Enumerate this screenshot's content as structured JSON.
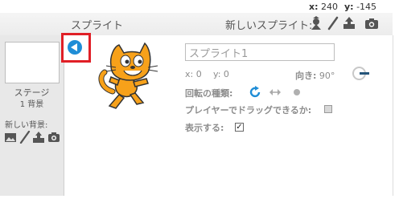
{
  "coords": {
    "x_label": "x:",
    "x_value": "240",
    "y_label": "y:",
    "y_value": "-145"
  },
  "sprites_pane": {
    "title": "スプライト",
    "new_sprite_label": "新しいスプライト:",
    "new_sprite_icons": [
      "sprite-library-icon",
      "paint-brush-icon",
      "upload-icon",
      "camera-icon"
    ]
  },
  "stage": {
    "label": "ステージ",
    "backdrop_count": "1 背景",
    "new_backdrop_label": "新しい背景:",
    "new_backdrop_icons": [
      "image-library-icon",
      "paint-brush-icon",
      "upload-icon",
      "camera-icon"
    ]
  },
  "sprite_info": {
    "name_value": "スプライト1",
    "x_label": "x:",
    "x_value": "0",
    "y_label": "y:",
    "y_value": "0",
    "direction_label": "向き:",
    "direction_value": "90°",
    "rotation_style_label": "回転の種類:",
    "draggable_label": "プレイヤーでドラッグできるか:",
    "draggable_checked": false,
    "show_label": "表示する:",
    "show_checked": true,
    "accent_color": "#1f8dd6",
    "highlight_color": "#e01f26"
  }
}
